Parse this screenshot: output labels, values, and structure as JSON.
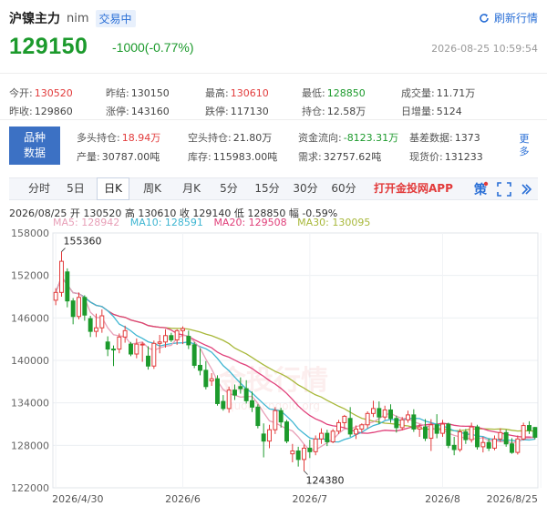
{
  "header": {
    "title": "沪镍主力",
    "code": "nim",
    "badge": "交易中",
    "refresh_label": "刷新行情"
  },
  "price": {
    "last": "129150",
    "change": "-1000(-0.77%)",
    "time": "2026-08-25 10:59:54"
  },
  "quote": {
    "row1": [
      {
        "label": "今开:",
        "value": "130520",
        "color": "red"
      },
      {
        "label": "昨结:",
        "value": "130150",
        "color": "dark"
      },
      {
        "label": "最高:",
        "value": "130610",
        "color": "red"
      },
      {
        "label": "最低:",
        "value": "128850",
        "color": "grn"
      },
      {
        "label": "成交量:",
        "value": "11.71万",
        "color": "dark"
      }
    ],
    "row2": [
      {
        "label": "昨收:",
        "value": "129860",
        "color": "dark"
      },
      {
        "label": "涨停:",
        "value": "143160",
        "color": "dark"
      },
      {
        "label": "跌停:",
        "value": "117130",
        "color": "dark"
      },
      {
        "label": "持仓:",
        "value": "12.58万",
        "color": "dark"
      },
      {
        "label": "日增量:",
        "value": "5124",
        "color": "dark"
      }
    ]
  },
  "variety": {
    "box_line1": "品种",
    "box_line2": "数据",
    "row1": [
      {
        "label": "多头持仓:",
        "value": "18.94万",
        "color": "red"
      },
      {
        "label": "空头持仓:",
        "value": "21.80万",
        "color": "dark"
      },
      {
        "label": "资金流向:",
        "value": "-8123.31万",
        "color": "grn"
      },
      {
        "label": "基差数据:",
        "value": "1373",
        "color": "dark"
      }
    ],
    "row2": [
      {
        "label": "产量:",
        "value": "30787.00吨",
        "color": "dark"
      },
      {
        "label": "库存:",
        "value": "115983.00吨",
        "color": "dark"
      },
      {
        "label": "需求:",
        "value": "32757.62吨",
        "color": "dark"
      },
      {
        "label": "现货价:",
        "value": "131233",
        "color": "dark"
      }
    ],
    "more_line1": "更",
    "more_line2": "多"
  },
  "tabs": [
    "分时",
    "5日",
    "日K",
    "周K",
    "月K",
    "5分",
    "15分",
    "30分",
    "60分"
  ],
  "active_tab": "日K",
  "app_button": "打开金投网APP",
  "ohlc": "2026/08/25  开 130520  高 130610  收 129140  低 128850  幅 -0.59%",
  "ma": {
    "ma5": "MA5: 128942",
    "ma10": "MA10: 128591",
    "ma20": "MA20: 129508",
    "ma30": "MA30: 130095"
  },
  "watermark": "金投行情",
  "watermark_url": "quote.cngold.org",
  "colors": {
    "up": "#e23b3b",
    "down": "#1c9a2c",
    "ma5": "#e8a0b8",
    "ma10": "#3fb6d2",
    "ma20": "#e0407a",
    "ma30": "#a8b83a",
    "accent": "#2a6fd6"
  },
  "chart_data": {
    "type": "candlestick",
    "ylim": [
      122000,
      158000
    ],
    "yticks": [
      122000,
      128000,
      134000,
      140000,
      146000,
      152000,
      158000
    ],
    "xticks": [
      {
        "label": "2026/4/30",
        "index": 0
      },
      {
        "label": "2026/6",
        "index": 22
      },
      {
        "label": "2026/7",
        "index": 44
      },
      {
        "label": "2026/8",
        "index": 67
      },
      {
        "label": "2026/8/25",
        "index": 84
      }
    ],
    "annotations": [
      {
        "text": "155360",
        "index": 1,
        "value": 155360,
        "pos": "above"
      },
      {
        "text": "124380",
        "index": 43,
        "value": 124380,
        "pos": "below"
      }
    ],
    "candles": [
      [
        148500,
        150200,
        147800,
        149600
      ],
      [
        149600,
        155360,
        149000,
        154000
      ],
      [
        152500,
        153000,
        147500,
        148400
      ],
      [
        148400,
        148800,
        145100,
        146200
      ],
      [
        146200,
        149600,
        145800,
        148900
      ],
      [
        148900,
        149200,
        145600,
        146400
      ],
      [
        145900,
        146300,
        143300,
        144100
      ],
      [
        144100,
        146600,
        143300,
        144600
      ],
      [
        144600,
        147200,
        143900,
        146300
      ],
      [
        142600,
        143400,
        140600,
        141600
      ],
      [
        141600,
        142100,
        139200,
        141500
      ],
      [
        141600,
        143800,
        141000,
        143300
      ],
      [
        143300,
        144900,
        142500,
        144200
      ],
      [
        142300,
        142600,
        140600,
        140900
      ],
      [
        140900,
        143100,
        140300,
        142300
      ],
      [
        142300,
        142600,
        139800,
        142300
      ],
      [
        140600,
        142000,
        138700,
        139200
      ],
      [
        139200,
        142800,
        138800,
        142400
      ],
      [
        142400,
        143600,
        141000,
        142600
      ],
      [
        142600,
        144400,
        141800,
        143500
      ],
      [
        143500,
        143900,
        142600,
        142900
      ],
      [
        142900,
        144400,
        142200,
        144200
      ],
      [
        144200,
        144800,
        142300,
        144500
      ],
      [
        143400,
        144200,
        141600,
        142200
      ],
      [
        142200,
        142600,
        138900,
        139300
      ],
      [
        139300,
        141700,
        137900,
        138600
      ],
      [
        138600,
        139900,
        135900,
        136300
      ],
      [
        137100,
        138200,
        136400,
        137400
      ],
      [
        137400,
        137900,
        133600,
        133900
      ],
      [
        134200,
        135100,
        132900,
        133200
      ],
      [
        133200,
        136300,
        132600,
        135800
      ],
      [
        135800,
        136600,
        134400,
        135100
      ],
      [
        136300,
        137600,
        135300,
        136000
      ],
      [
        136000,
        137200,
        133900,
        134300
      ],
      [
        134300,
        135600,
        132700,
        133400
      ],
      [
        133400,
        133800,
        130400,
        130800
      ],
      [
        129600,
        131100,
        126300,
        128600
      ],
      [
        128600,
        130900,
        127600,
        130200
      ],
      [
        130200,
        133400,
        129600,
        132900
      ],
      [
        132900,
        133300,
        130500,
        131300
      ],
      [
        131300,
        131600,
        128300,
        128600
      ],
      [
        126800,
        128200,
        125600,
        127200
      ],
      [
        127200,
        127800,
        125000,
        126000
      ],
      [
        126000,
        128100,
        124380,
        127600
      ],
      [
        127600,
        128800,
        126200,
        127100
      ],
      [
        127100,
        129400,
        126600,
        128900
      ],
      [
        128900,
        130400,
        128200,
        129700
      ],
      [
        129700,
        130200,
        127900,
        128500
      ],
      [
        128500,
        130300,
        128300,
        130000
      ],
      [
        130000,
        131600,
        129600,
        131200
      ],
      [
        131200,
        132300,
        130400,
        132100
      ],
      [
        131800,
        133400,
        129200,
        129600
      ],
      [
        129600,
        130800,
        128900,
        130300
      ],
      [
        130300,
        131100,
        129800,
        130900
      ],
      [
        130900,
        132800,
        130400,
        132500
      ],
      [
        132500,
        134300,
        132000,
        133200
      ],
      [
        133200,
        134200,
        131000,
        132000
      ],
      [
        132000,
        133600,
        131600,
        133000
      ],
      [
        133000,
        133800,
        131200,
        131800
      ],
      [
        131800,
        132200,
        129800,
        130500
      ],
      [
        130500,
        132000,
        130100,
        131600
      ],
      [
        131600,
        132900,
        131200,
        132300
      ],
      [
        132300,
        133100,
        129900,
        130300
      ],
      [
        130300,
        131000,
        129200,
        130600
      ],
      [
        130600,
        131700,
        128600,
        129000
      ],
      [
        129000,
        131700,
        127200,
        130900
      ],
      [
        130900,
        132400,
        129000,
        129700
      ],
      [
        129700,
        131600,
        129200,
        131000
      ],
      [
        131000,
        131200,
        127600,
        128000
      ],
      [
        128000,
        129200,
        126600,
        127400
      ],
      [
        127400,
        130300,
        127100,
        129900
      ],
      [
        129900,
        130300,
        128200,
        128800
      ],
      [
        128800,
        131200,
        128400,
        130600
      ],
      [
        130600,
        130900,
        127400,
        127800
      ],
      [
        127800,
        129200,
        127000,
        128400
      ],
      [
        128400,
        129000,
        127200,
        127600
      ],
      [
        127600,
        129400,
        127300,
        128900
      ],
      [
        128900,
        130400,
        128500,
        129800
      ],
      [
        129800,
        130200,
        127800,
        128200
      ],
      [
        128200,
        129000,
        126800,
        127000
      ],
      [
        127000,
        129400,
        126700,
        128900
      ],
      [
        128900,
        131200,
        128700,
        130800
      ],
      [
        130800,
        131400,
        129600,
        130100
      ],
      [
        130520,
        130610,
        128850,
        129140
      ]
    ]
  }
}
